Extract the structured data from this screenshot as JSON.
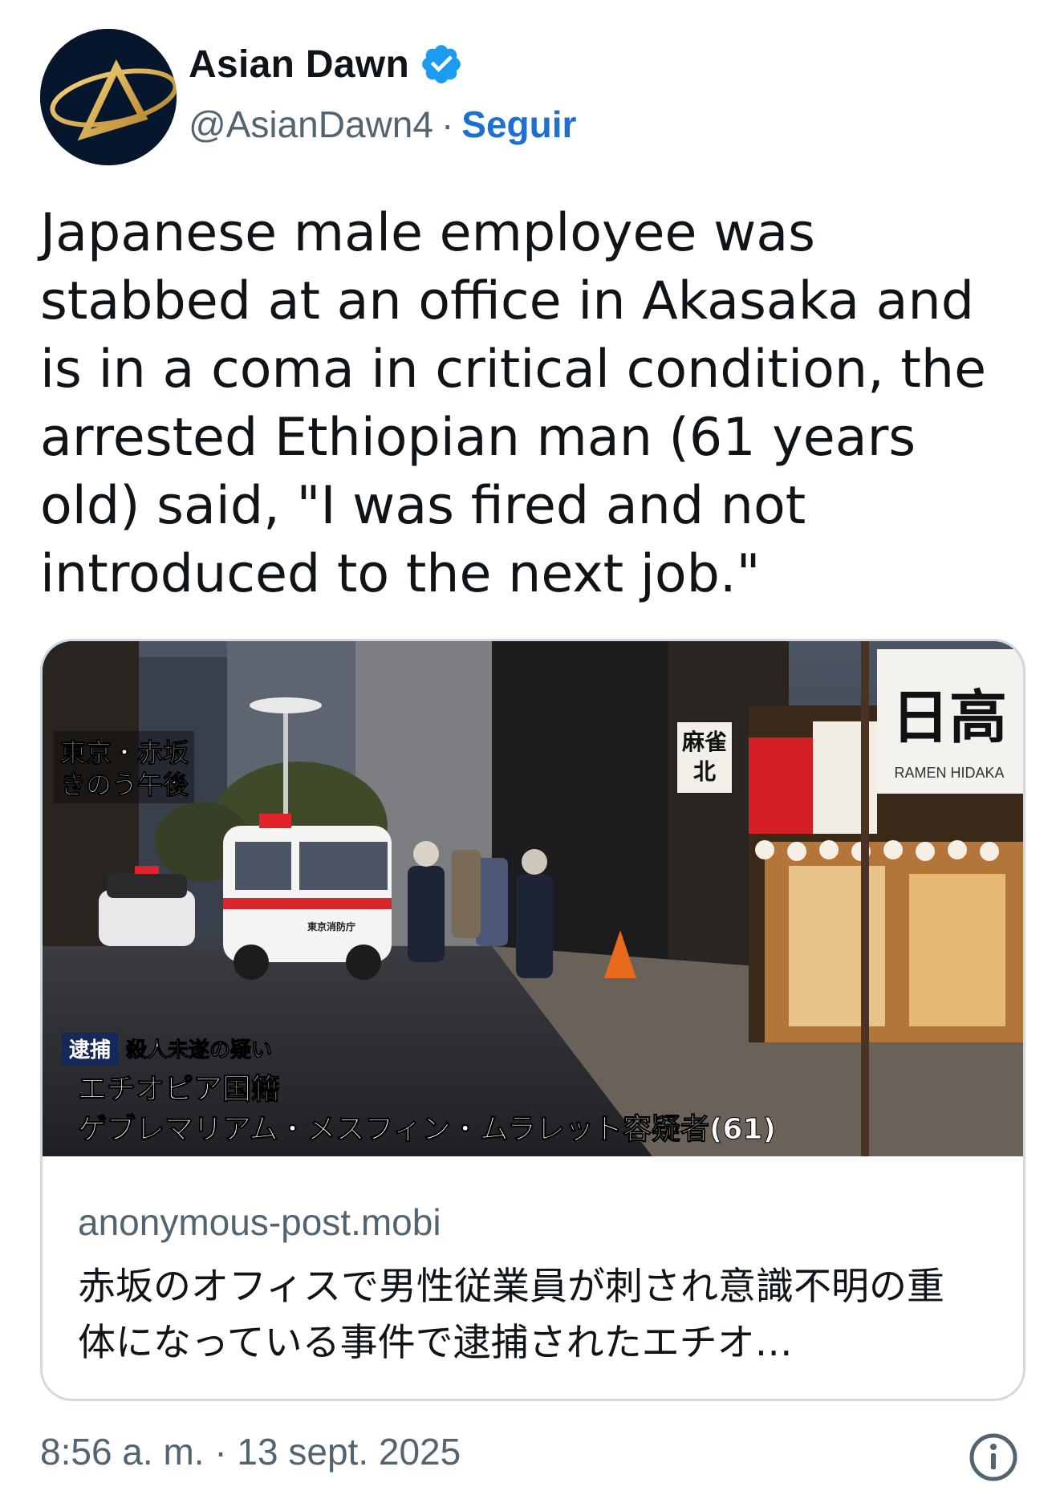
{
  "author": {
    "name": "Asian Dawn",
    "handle": "@AsianDawn4",
    "separator": "·",
    "follow_label": "Seguir"
  },
  "tweet": {
    "text": "Japanese male employee was stabbed at an office in Akasaka and is in a coma in critical condition, the arrested Ethiopian man (61 years old) said, \"I was fired and not introduced to the next job.\""
  },
  "card": {
    "image_captions": {
      "location": "東京・赤坂",
      "time": "きのう午後",
      "arrest_badge": "逮捕",
      "charge": "殺人未遂の疑い",
      "nationality": "エチオピア国籍",
      "suspect": "ゲブレマリアム・メスフィン・ムラレット容疑者(61)",
      "sign_mahjong": "麻雀北",
      "shop_name": "日高",
      "shop_subtitle": "RAMEN HIDAKA",
      "ambulance_text": "東京消防庁"
    },
    "domain": "anonymous-post.mobi",
    "description": "赤坂のオフィスで男性従業員が刺され意識不明の重体になっている事件で逮捕されたエチオ…"
  },
  "timestamp": "8:56 a. m. · 13 sept. 2025",
  "icons": [
    "avatar-logo",
    "verified-badge-icon",
    "info-icon"
  ],
  "colors": {
    "link": "#1d6fd1",
    "verified": "#1d9bf0",
    "secondary": "#536471",
    "border": "#cfd9de"
  }
}
